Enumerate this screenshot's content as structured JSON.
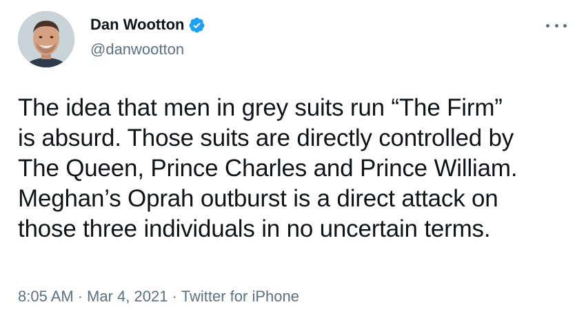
{
  "author": {
    "display_name": "Dan Wootton",
    "handle": "@danwootton",
    "verified": true
  },
  "tweet": {
    "lines": [
      "The idea that men in grey suits run “The Firm”",
      "is absurd. Those suits are directly controlled by",
      "The Queen, Prince Charles and Prince William.",
      "Meghan’s Oprah outburst is a direct attack on",
      "those three individuals in no uncertain terms."
    ]
  },
  "meta": {
    "time": "8:05 AM",
    "separator": "·",
    "date": "Mar 4, 2021",
    "source": "Twitter for iPhone"
  },
  "icons": {
    "verified": "verified-badge-icon",
    "more": "more-options-icon"
  },
  "colors": {
    "verified": "#1da1f2",
    "text": "#0f1419",
    "secondary": "#5b7083"
  }
}
